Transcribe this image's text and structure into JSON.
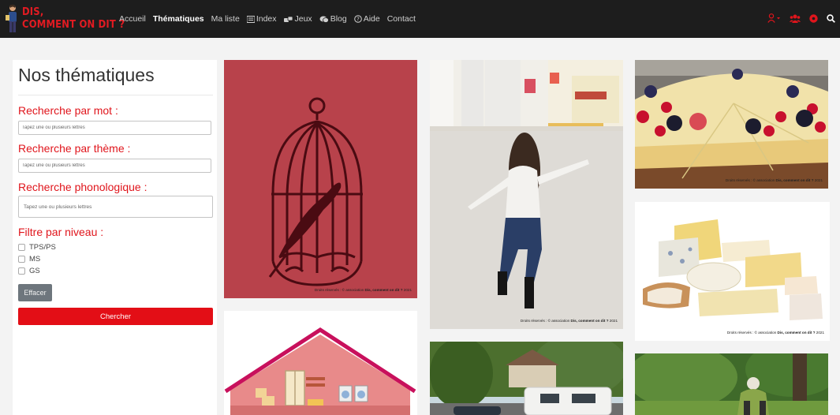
{
  "brand": {
    "line1": "DIS,",
    "line2": "COMMENT ON DIT ?"
  },
  "nav": {
    "links": [
      {
        "label": "Accueil",
        "icon": ""
      },
      {
        "label": "Thématiques",
        "icon": ""
      },
      {
        "label": "Ma liste",
        "icon": ""
      },
      {
        "label": "Index",
        "icon": "list-icon"
      },
      {
        "label": "Jeux",
        "icon": "game-icon"
      },
      {
        "label": "Blog",
        "icon": "blog-icon"
      },
      {
        "label": "Aide",
        "icon": "help-icon"
      },
      {
        "label": "Contact",
        "icon": ""
      }
    ],
    "right_icons": [
      "user-icon",
      "group-icon",
      "settings-icon",
      "search-icon"
    ],
    "accent": "#e0151c"
  },
  "sidebar": {
    "title": "Nos thématiques",
    "word_search": {
      "label": "Recherche par mot :",
      "placeholder": "Tapez une ou plusieurs lettres"
    },
    "theme_search": {
      "label": "Recherche par thème :",
      "placeholder": "Tapez une ou plusieurs lettres"
    },
    "phono_search": {
      "label": "Recherche phonologique :",
      "placeholder": "Tapez une ou plusieurs lettres"
    },
    "level_filter": {
      "label": "Filtre par niveau :",
      "options": [
        "TPS/PS",
        "MS",
        "GS"
      ]
    },
    "clear_label": "Effacer",
    "search_label": "Chercher"
  },
  "cards": {
    "credit_prefix": "Droits réservés : © association ",
    "credit_org": "Dis, comment on dit ?",
    "credit_year": " 2021",
    "items": [
      {
        "name": "birdcage-card",
        "subject": "birdcage-image"
      },
      {
        "name": "house-card",
        "subject": "house-image"
      },
      {
        "name": "child-dancing-card",
        "subject": "child-dancing-image"
      },
      {
        "name": "caravan-card",
        "subject": "caravan-image"
      },
      {
        "name": "cheesecake-card",
        "subject": "cheesecake-image"
      },
      {
        "name": "cheeses-card",
        "subject": "cheeses-image"
      },
      {
        "name": "gardener-card",
        "subject": "gardener-image"
      }
    ]
  }
}
